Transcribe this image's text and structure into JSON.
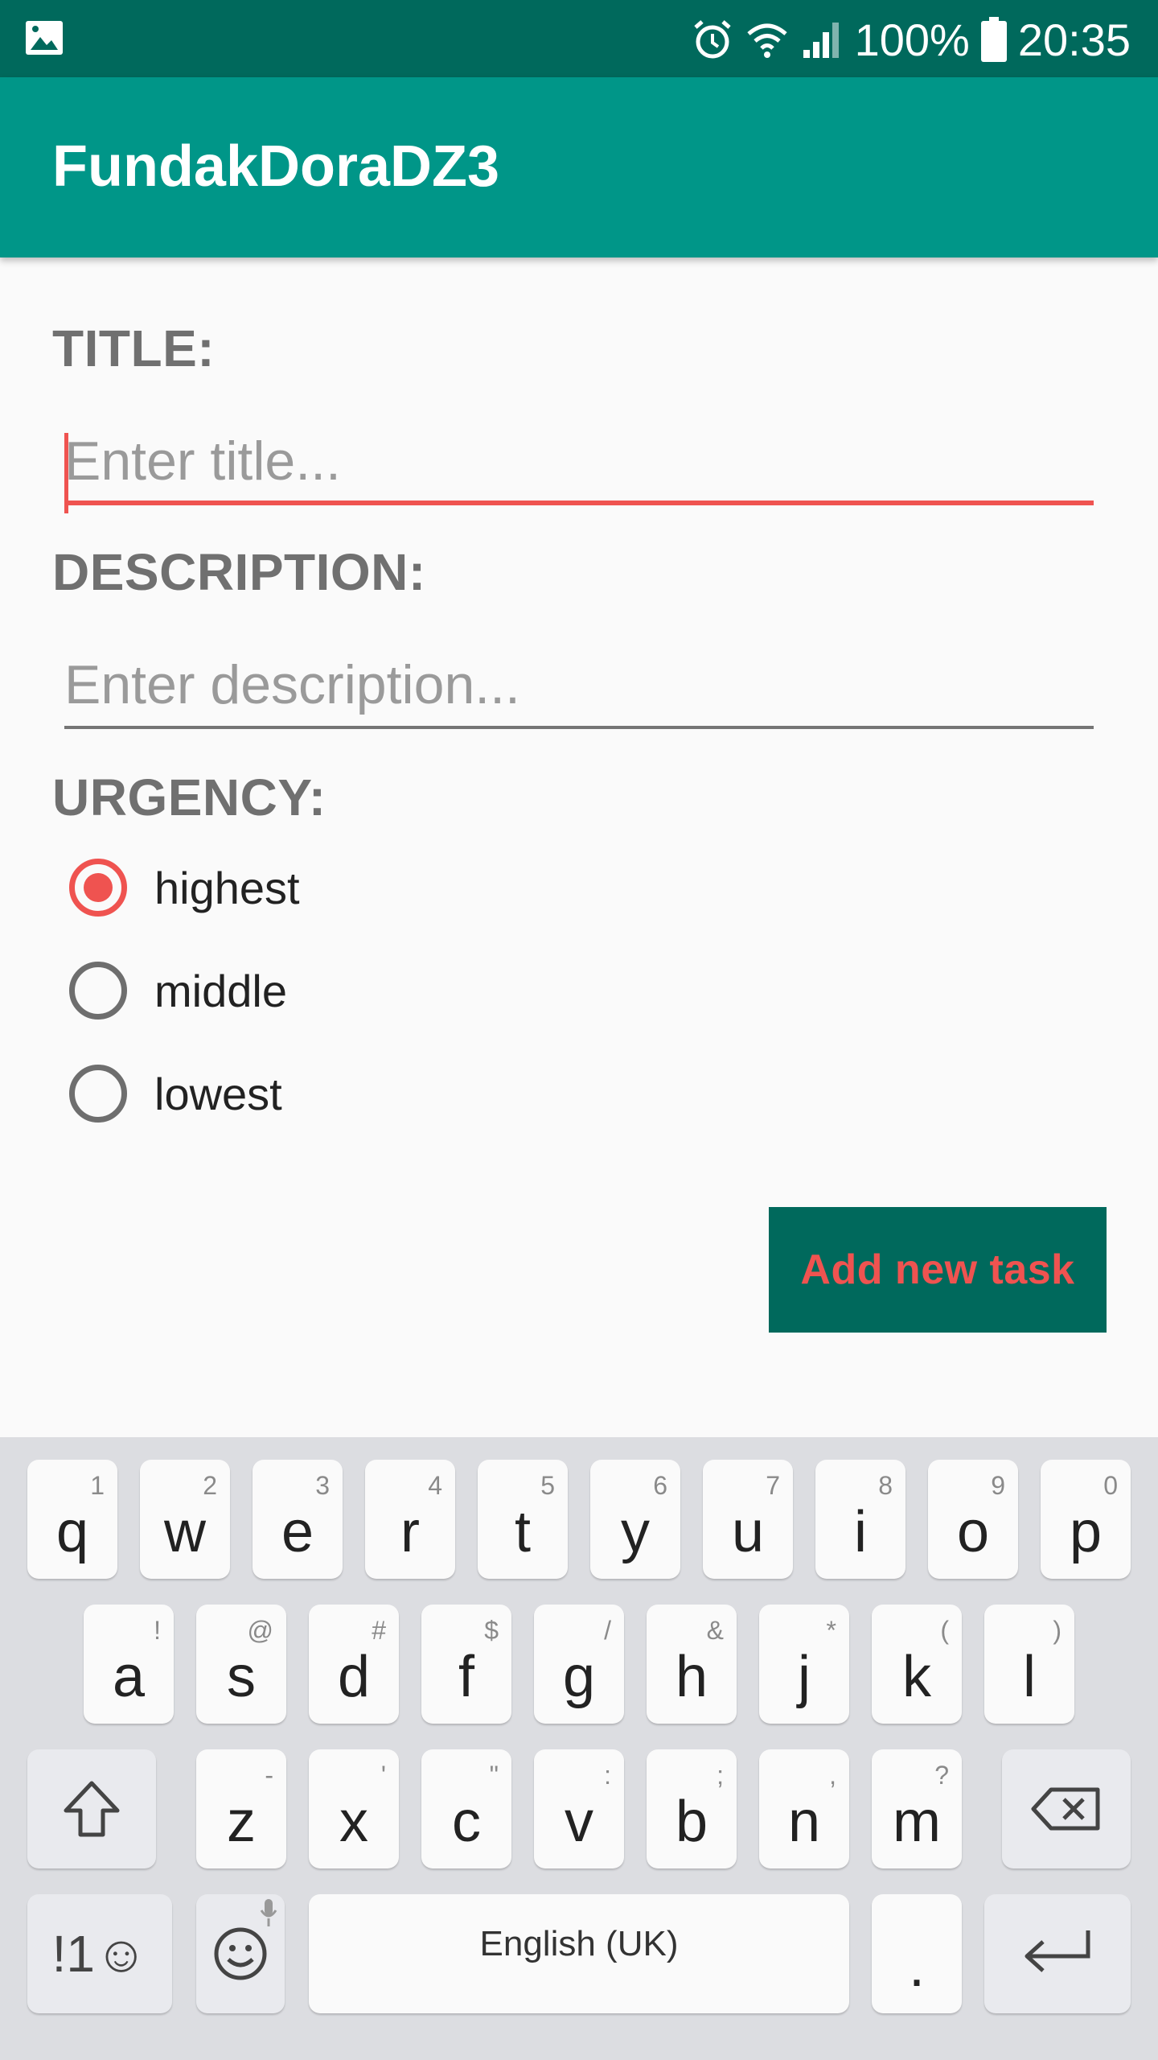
{
  "status_bar": {
    "battery": "100%",
    "time": "20:35",
    "icons": [
      "image-icon",
      "alarm-icon",
      "wifi-icon",
      "signal-icon",
      "battery-icon"
    ]
  },
  "app_bar": {
    "title": "FundakDoraDZ3"
  },
  "form": {
    "title_label": "TITLE:",
    "title_placeholder": "Enter title...",
    "description_label": "DESCRIPTION:",
    "description_placeholder": "Enter description...",
    "urgency_label": "URGENCY:",
    "urgency_options": [
      {
        "label": "highest",
        "checked": true
      },
      {
        "label": "middle",
        "checked": false
      },
      {
        "label": "lowest",
        "checked": false
      }
    ],
    "add_button": "Add new task"
  },
  "keyboard": {
    "row1": [
      {
        "k": "q",
        "h": "1"
      },
      {
        "k": "w",
        "h": "2"
      },
      {
        "k": "e",
        "h": "3"
      },
      {
        "k": "r",
        "h": "4"
      },
      {
        "k": "t",
        "h": "5"
      },
      {
        "k": "y",
        "h": "6"
      },
      {
        "k": "u",
        "h": "7"
      },
      {
        "k": "i",
        "h": "8"
      },
      {
        "k": "o",
        "h": "9"
      },
      {
        "k": "p",
        "h": "0"
      }
    ],
    "row2": [
      {
        "k": "a",
        "h": "!"
      },
      {
        "k": "s",
        "h": "@"
      },
      {
        "k": "d",
        "h": "#"
      },
      {
        "k": "f",
        "h": "$"
      },
      {
        "k": "g",
        "h": "/"
      },
      {
        "k": "h",
        "h": "&"
      },
      {
        "k": "j",
        "h": "*"
      },
      {
        "k": "k",
        "h": "("
      },
      {
        "k": "l",
        "h": ")"
      }
    ],
    "row3": [
      {
        "k": "z",
        "h": "-"
      },
      {
        "k": "x",
        "h": "'"
      },
      {
        "k": "c",
        "h": "\""
      },
      {
        "k": "v",
        "h": ":"
      },
      {
        "k": "b",
        "h": ";"
      },
      {
        "k": "n",
        "h": ","
      },
      {
        "k": "m",
        "h": "?"
      }
    ],
    "symbols_key": "!1☺",
    "space_label": "English (UK)",
    "period_key": ".",
    "colors": {
      "accent": "#ef5350",
      "primary": "#009688",
      "primary_dark": "#00695c"
    }
  }
}
